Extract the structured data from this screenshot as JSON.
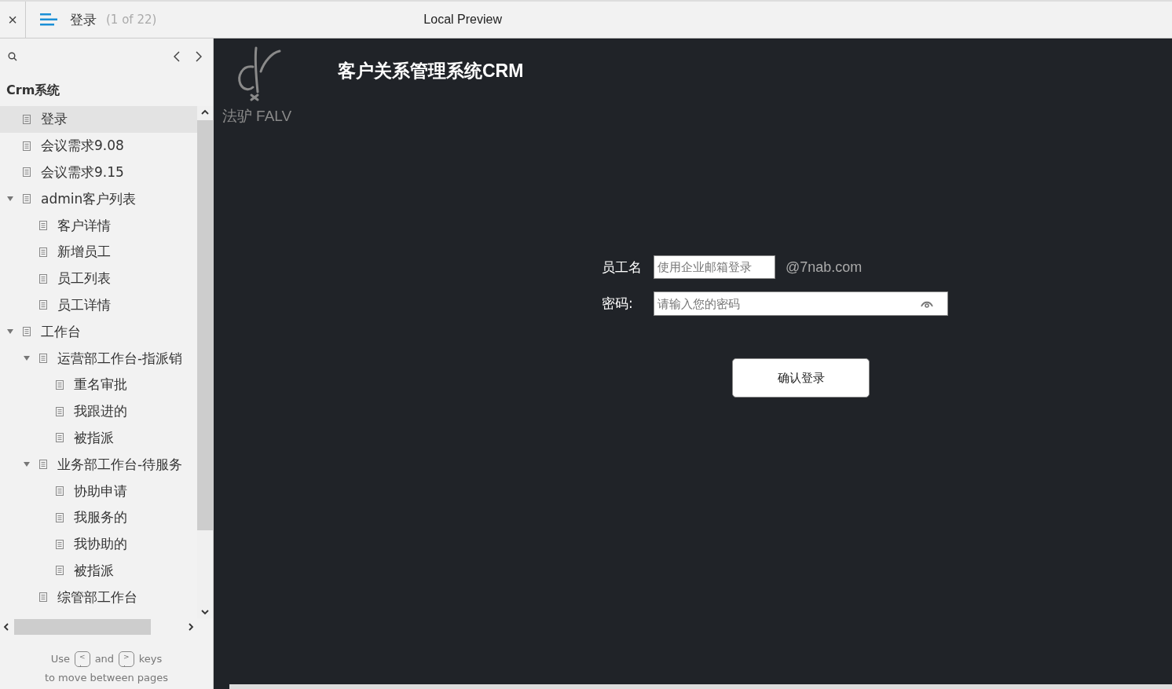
{
  "toolbar": {
    "close": "×",
    "page_title": "登录",
    "page_count": "(1 of 22)",
    "preview_title": "Local Preview"
  },
  "sidebar": {
    "project": "Crm系统",
    "items": [
      {
        "label": "登录",
        "selected": true
      },
      {
        "label": "会议需求9.08",
        "selected": false
      },
      {
        "label": "会议需求9.15",
        "selected": false
      },
      {
        "label": "admin客户列表",
        "selected": false,
        "expanded": true,
        "children": [
          {
            "label": "客户详情",
            "selected": false
          },
          {
            "label": "新增员工",
            "selected": false
          },
          {
            "label": "员工列表",
            "selected": false
          },
          {
            "label": "员工详情",
            "selected": false
          }
        ]
      },
      {
        "label": "工作台",
        "selected": false,
        "expanded": true,
        "children": [
          {
            "label": "运营部工作台-指派销",
            "selected": false,
            "expanded": true,
            "children": [
              {
                "label": "重名审批",
                "selected": false
              },
              {
                "label": "我跟进的",
                "selected": false
              },
              {
                "label": "被指派",
                "selected": false
              }
            ]
          },
          {
            "label": "业务部工作台-待服务",
            "selected": false,
            "expanded": true,
            "children": [
              {
                "label": "协助申请",
                "selected": false
              },
              {
                "label": "我服务的",
                "selected": false
              },
              {
                "label": "我协助的",
                "selected": false
              },
              {
                "label": "被指派",
                "selected": false
              }
            ]
          },
          {
            "label": "综管部工作台",
            "selected": false
          }
        ]
      }
    ],
    "hint": {
      "use": "Use",
      "key_prev_top": "<",
      "key_prev_bottom": ",",
      "and": "and",
      "key_next_top": ">",
      "key_next_bottom": ".",
      "keys": "keys",
      "line2": "to move between pages"
    }
  },
  "page": {
    "logo_text": "法驴 FALV",
    "title": "客户关系管理系统CRM",
    "form": {
      "username_label": "员工名",
      "username_placeholder": "使用企业邮箱登录",
      "domain": "@7nab.com",
      "password_label": "密码:",
      "password_placeholder": "请输入您的密码",
      "submit": "确认登录"
    }
  }
}
